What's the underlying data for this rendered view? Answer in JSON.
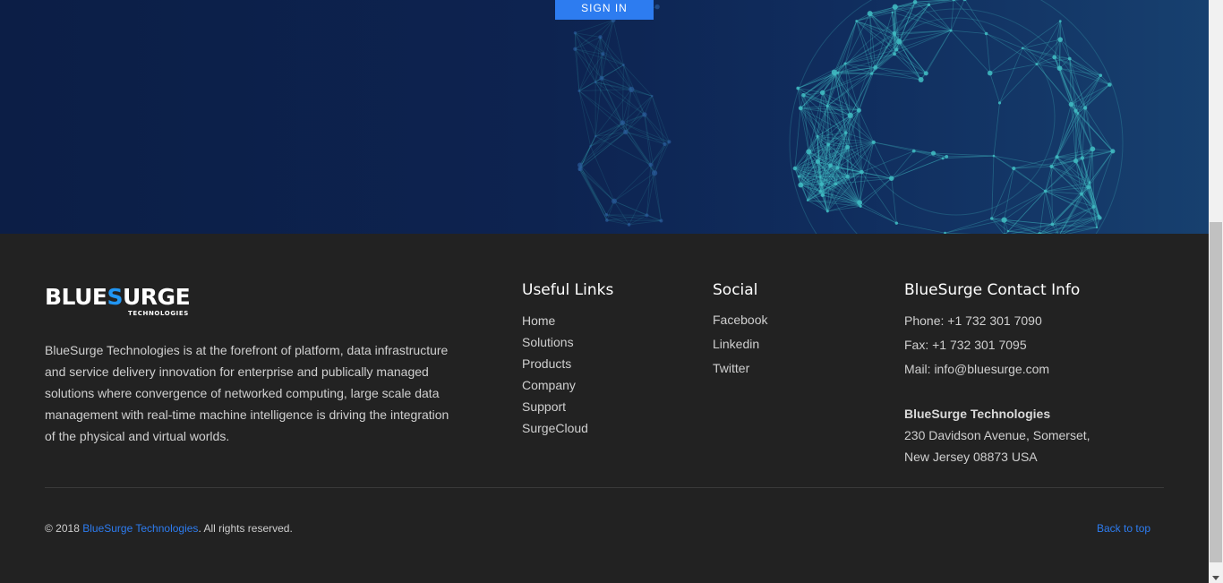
{
  "hero": {
    "signin_label": "SIGN IN"
  },
  "logo": {
    "part1": "BLUE",
    "part2": "S",
    "part3": "URGE",
    "subtitle": "TECHNOLOGIES"
  },
  "about": "BlueSurge Technologies is at the forefront of platform, data infrastructure and service delivery innovation for enterprise and publically managed solutions where convergence of networked computing, large scale data management with real-time machine intelligence is driving the integration of the physical and virtual worlds.",
  "useful_links": {
    "title": "Useful Links",
    "items": [
      "Home",
      "Solutions",
      "Products",
      "Company",
      "Support",
      "SurgeCloud"
    ]
  },
  "social": {
    "title": "Social",
    "items": [
      "Facebook",
      "Linkedin",
      "Twitter"
    ]
  },
  "contact": {
    "title": "BlueSurge Contact Info",
    "phone": "Phone: +1 732 301 7090",
    "fax": "Fax: +1 732 301 7095",
    "mail": "Mail: info@bluesurge.com",
    "company": "BlueSurge Technologies",
    "address1": "230 Davidson Avenue, Somerset,",
    "address2": "New Jersey 08873 USA"
  },
  "copyright": {
    "prefix": "© 2018 ",
    "brand": "BlueSurge Technologies",
    "suffix": ". All rights reserved."
  },
  "back_to_top": "Back to top",
  "colors": {
    "accent": "#2d7cf0",
    "footer_bg": "#222222",
    "hero_bg": "#0d2350",
    "network": "#3fb8c0"
  }
}
